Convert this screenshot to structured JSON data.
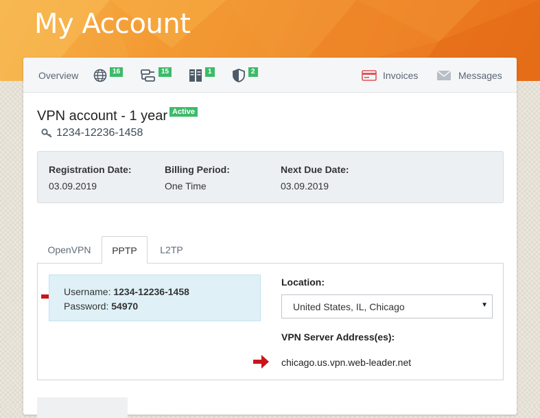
{
  "header": {
    "title": "My Account"
  },
  "nav": {
    "overview_label": "Overview",
    "globe_count": "16",
    "network_count": "15",
    "server_count": "1",
    "shield_count": "2",
    "invoices_label": "Invoices",
    "messages_label": "Messages"
  },
  "service": {
    "title": "VPN account - 1 year",
    "status": "Active",
    "account_id": "1234-12236-1458"
  },
  "details": {
    "registration_label": "Registration Date:",
    "registration_value": "03.09.2019",
    "billing_label": "Billing Period:",
    "billing_value": "One Time",
    "due_label": "Next Due Date:",
    "due_value": "03.09.2019"
  },
  "tabs": [
    {
      "label": "OpenVPN",
      "active": false
    },
    {
      "label": "PPTP",
      "active": true
    },
    {
      "label": "L2TP",
      "active": false
    }
  ],
  "credentials": {
    "username_label": "Username:",
    "username_value": "1234-12236-1458",
    "password_label": "Password:",
    "password_value": "54970"
  },
  "location": {
    "label": "Location:",
    "selected": "United States, IL, Chicago"
  },
  "server": {
    "label": "VPN Server Address(es):",
    "address": "chicago.us.vpn.web-leader.net"
  },
  "colors": {
    "accent_orange": "#ef8326",
    "badge_green": "#3dbb69",
    "arrow_red": "#c8151b",
    "invoice_red": "#e2515a"
  },
  "icons": [
    "globe-icon",
    "network-icon",
    "server-icon",
    "shield-icon",
    "invoice-icon",
    "envelope-icon",
    "key-icon",
    "arrow-right-icon"
  ]
}
